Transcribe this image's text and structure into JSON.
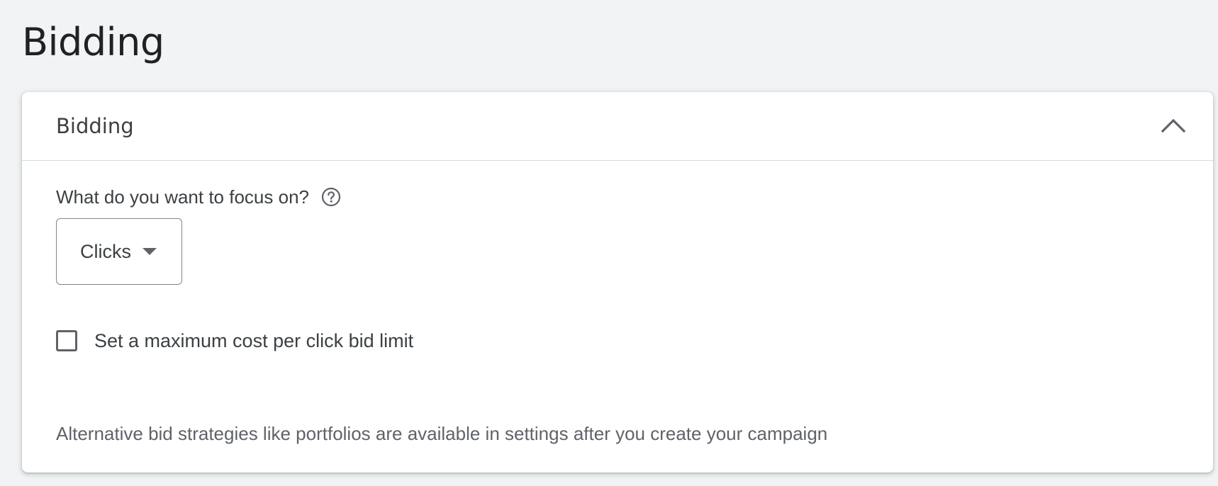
{
  "page": {
    "title": "Bidding"
  },
  "card": {
    "title": "Bidding",
    "collapse_icon": "chevron-up-icon",
    "question": "What do you want to focus on?",
    "help_icon": "help-circle-icon",
    "focus_select": {
      "value": "Clicks"
    },
    "max_cpc_checkbox": {
      "label": "Set a maximum cost per click bid limit",
      "checked": false
    },
    "footnote": "Alternative bid strategies like portfolios are available in settings after you create your campaign"
  },
  "colors": {
    "background": "#f1f3f4",
    "card": "#ffffff",
    "text_primary": "#202124",
    "text_secondary": "#3c4043",
    "text_muted": "#5f6368",
    "border": "#dadce0"
  }
}
